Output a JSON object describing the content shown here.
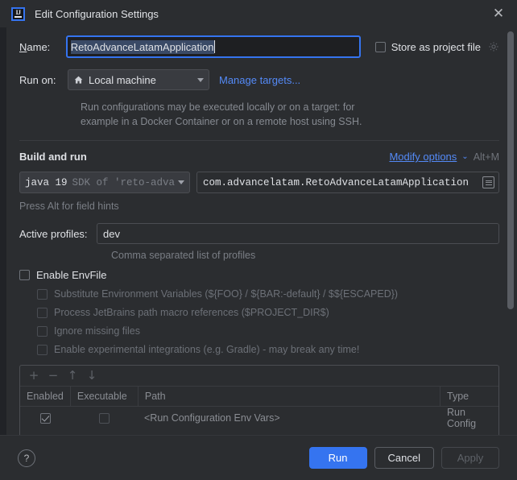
{
  "window": {
    "title": "Edit Configuration Settings",
    "logo_text": "IJ",
    "close_label": "✕"
  },
  "name_row": {
    "label": "Name:",
    "label_mnemonic": "N",
    "label_rest": "ame:",
    "value": "RetoAdvanceLatamApplication",
    "store_checkbox_label": "Store as project file",
    "store_checked": false
  },
  "run_on": {
    "label": "Run on:",
    "selected": "Local machine",
    "manage_link": "Manage targets..."
  },
  "hint": {
    "line1": "Run configurations may be executed locally or on a target: for",
    "line2": "example in a Docker Container or on a remote host using SSH."
  },
  "build_and_run": {
    "title": "Build and run",
    "modify_options": "Modify options",
    "chevron": "⌄",
    "shortcut": "Alt+M",
    "jdk_main": "java 19",
    "jdk_sub": "SDK of 'reto-advar",
    "main_class": "com.advancelatam.RetoAdvanceLatamApplication",
    "field_hint": "Press Alt for field hints"
  },
  "profiles": {
    "label": "Active profiles:",
    "value": "dev",
    "note": "Comma separated list of profiles"
  },
  "envfile": {
    "enable_label": "Enable EnvFile",
    "enable_checked": false,
    "options": [
      {
        "label": "Substitute Environment Variables (${FOO} / ${BAR:-default} / $${ESCAPED})",
        "checked": false
      },
      {
        "label": "Process JetBrains path macro references ($PROJECT_DIR$)",
        "checked": false
      },
      {
        "label": "Ignore missing files",
        "checked": false
      },
      {
        "label": "Enable experimental integrations (e.g. Gradle) - may break any time!",
        "checked": false
      }
    ]
  },
  "env_table": {
    "toolbar": {
      "add": "+",
      "remove": "−",
      "move_up": "↑",
      "move_down": "↓"
    },
    "columns": [
      "Enabled",
      "Executable",
      "Path",
      "Type"
    ],
    "rows": [
      {
        "enabled": true,
        "executable": false,
        "path": "<Run Configuration Env Vars>",
        "type": "Run Config"
      }
    ]
  },
  "footer": {
    "help": "?",
    "run": "Run",
    "cancel": "Cancel",
    "apply": "Apply"
  },
  "colors": {
    "accent": "#3574F0",
    "link": "#548AF7",
    "background": "#2B2D30",
    "field_background": "#1E1F22",
    "selection": "#3A4A66",
    "border": "#4B4D52",
    "text": "#DFE1E5",
    "text_muted": "#7A7E85",
    "text_disabled": "#6C7077"
  }
}
